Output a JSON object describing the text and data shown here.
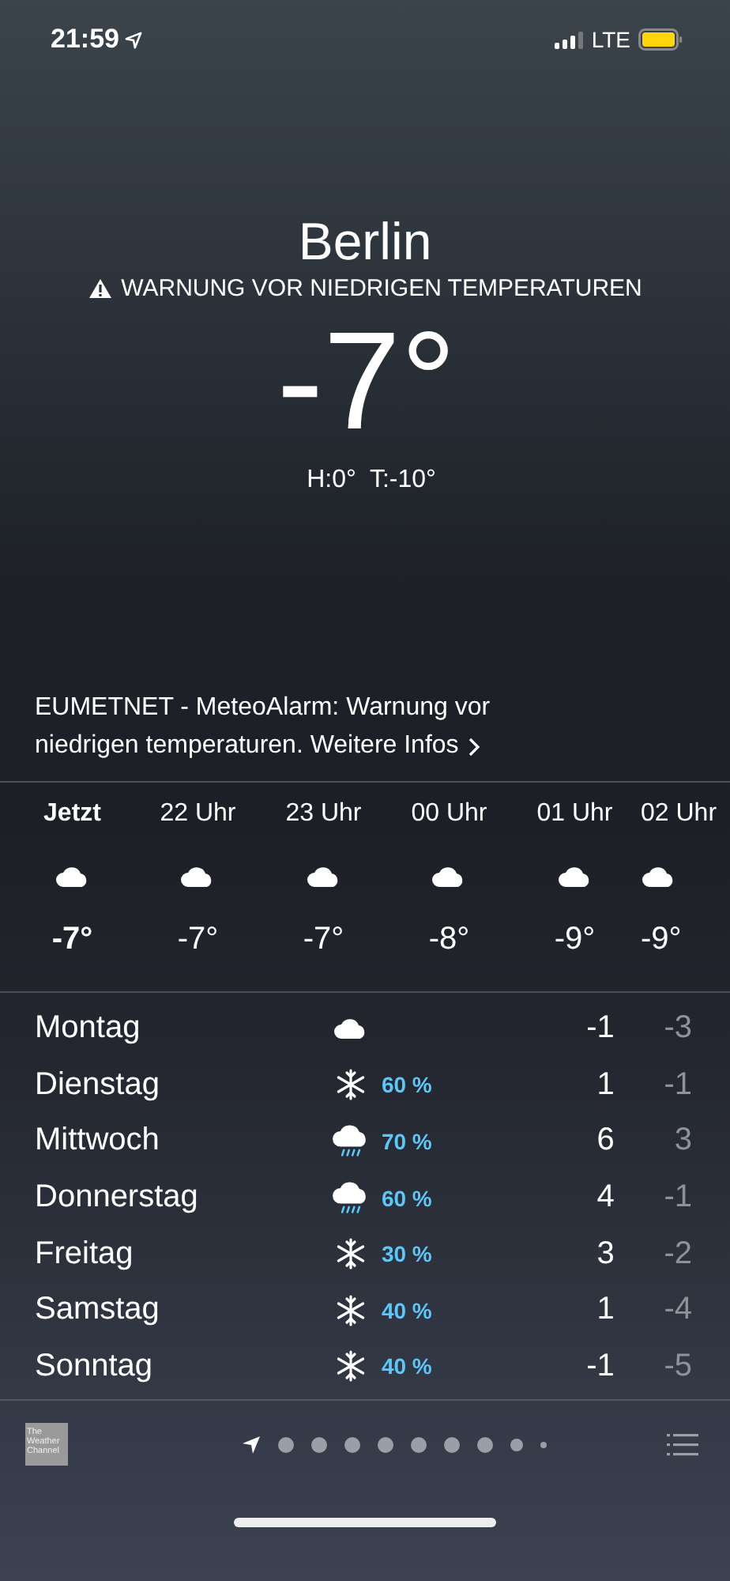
{
  "status_bar": {
    "time": "21:59",
    "network": "LTE"
  },
  "city": "Berlin",
  "warning": "WARNUNG VOR NIEDRIGEN TEMPERATUREN",
  "temperature": "-7°",
  "high_low": "H:0°  T:-10°",
  "alert": {
    "text": "EUMETNET - MeteoAlarm: Warnung vor niedrigen temperaturen.",
    "link": "Weitere Infos"
  },
  "hourly": [
    {
      "time": "Jetzt",
      "temp": "-7°",
      "current": true
    },
    {
      "time": "22 Uhr",
      "temp": "-7°",
      "current": false
    },
    {
      "time": "23 Uhr",
      "temp": "-7°",
      "current": false
    },
    {
      "time": "00 Uhr",
      "temp": "-8°",
      "current": false
    },
    {
      "time": "01 Uhr",
      "temp": "-9°",
      "current": false
    },
    {
      "time": "02 Uhr",
      "temp": "-9°",
      "current": false
    }
  ],
  "daily": [
    {
      "day": "Montag",
      "kind": "cloud",
      "high": "-1",
      "low": "-3"
    },
    {
      "day": "Dienstag",
      "kind": "snow",
      "chance": "60 %",
      "high": "1",
      "low": "-1"
    },
    {
      "day": "Mittwoch",
      "kind": "rain",
      "chance": "70 %",
      "high": "6",
      "low": "3"
    },
    {
      "day": "Donnerstag",
      "kind": "rain",
      "chance": "60 %",
      "high": "4",
      "low": "-1"
    },
    {
      "day": "Freitag",
      "kind": "snow",
      "chance": "30 %",
      "high": "3",
      "low": "-2"
    },
    {
      "day": "Samstag",
      "kind": "snow",
      "chance": "40 %",
      "high": "1",
      "low": "-4"
    },
    {
      "day": "Sonntag",
      "kind": "snow",
      "chance": "40 %",
      "high": "-1",
      "low": "-5"
    }
  ],
  "footer": {
    "logo": "The Weather Channel",
    "pages": [
      {
        "kind": "location",
        "selected": true
      },
      {
        "kind": "dot",
        "selected": false
      },
      {
        "kind": "dot",
        "selected": false
      },
      {
        "kind": "dot",
        "selected": false
      },
      {
        "kind": "dot",
        "selected": false
      },
      {
        "kind": "dot",
        "selected": false
      },
      {
        "kind": "dot",
        "selected": false
      },
      {
        "kind": "dot",
        "selected": false
      },
      {
        "kind": "small",
        "selected": false
      },
      {
        "kind": "tiny",
        "selected": false
      }
    ]
  }
}
